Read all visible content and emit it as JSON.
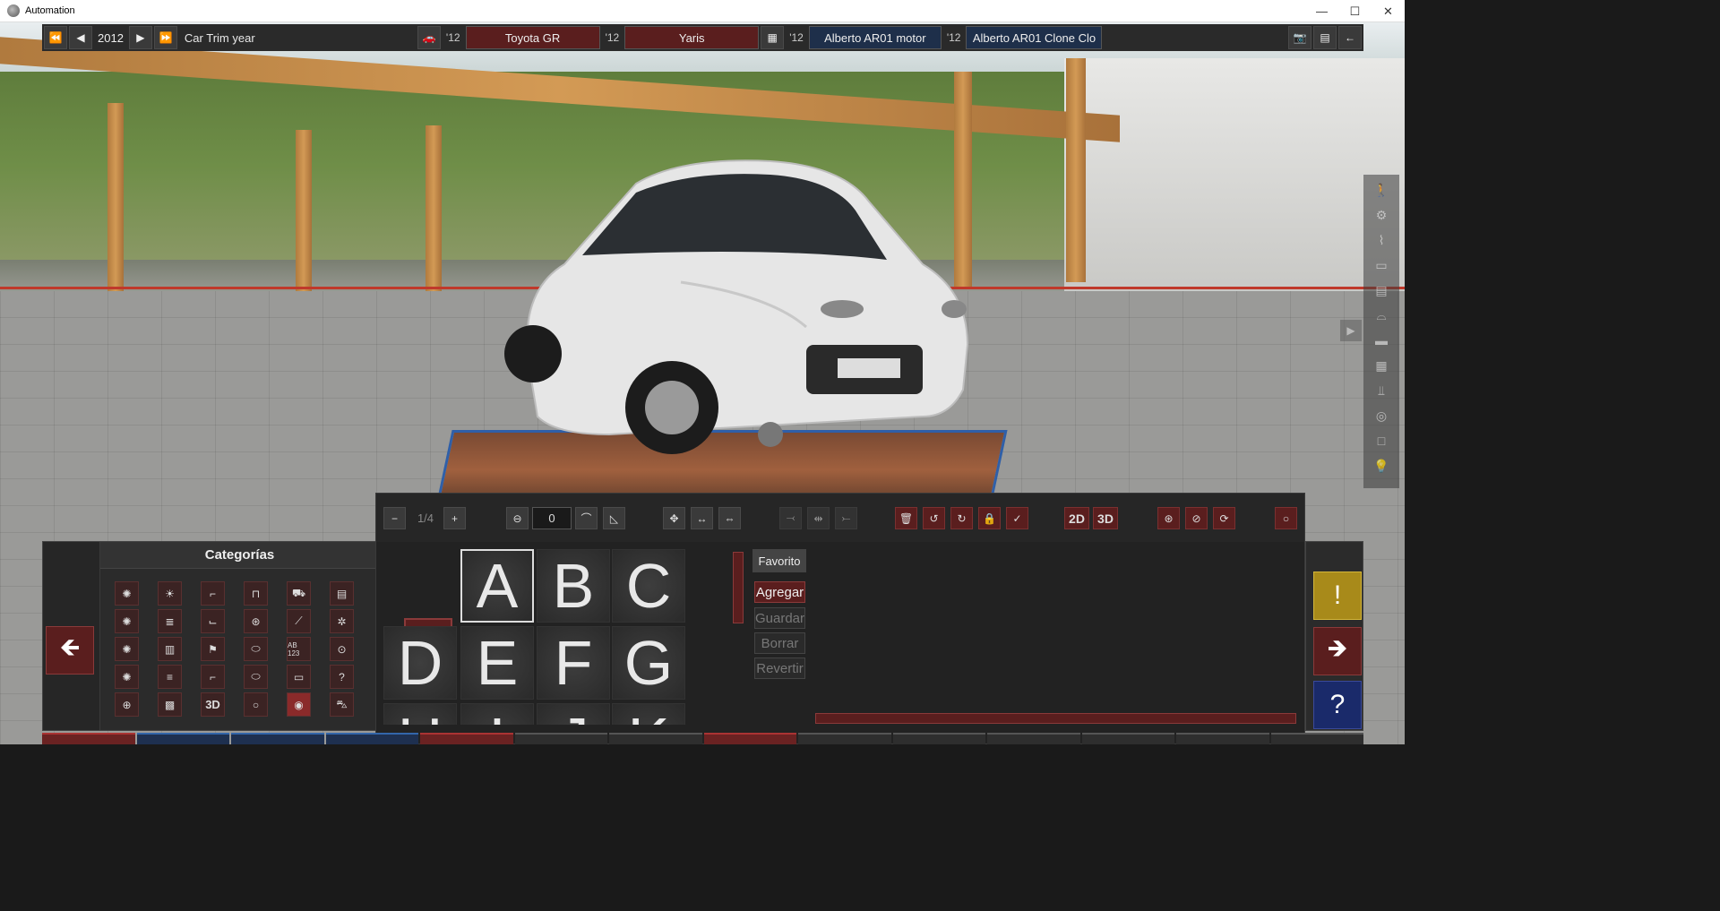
{
  "window": {
    "title": "Automation"
  },
  "os_controls": {
    "minimize": "—",
    "maximize": "☐",
    "close": "✕"
  },
  "topbar": {
    "year": "2012",
    "year_label": "Car Trim year",
    "model_year": "'12",
    "model_family": "Toyota GR",
    "trim_year": "'12",
    "trim_name": "Yaris",
    "engine_year": "'12",
    "engine_family": "Alberto AR01 motor",
    "variant_year": "'12",
    "variant_name": "Alberto AR01 Clone Clo"
  },
  "categories": {
    "title": "Categorías"
  },
  "editor": {
    "layer_count": "1/4",
    "rotation_value": "0",
    "btn_2d": "2D",
    "btn_3d": "3D",
    "glyphs": [
      "A",
      "B",
      "C",
      "D",
      "E",
      "F",
      "G",
      "H",
      "I",
      "J",
      "K"
    ],
    "favorite": "Favorito",
    "add": "Agregar",
    "save": "Guardar",
    "delete": "Borrar",
    "revert": "Revertir"
  },
  "cat_3d_label": "3D",
  "cat_ab_label": "AB 123",
  "colors": {
    "accent_red": "#5a1e1e",
    "warning": "#a88a1a",
    "help_blue": "#1a2a6a"
  }
}
